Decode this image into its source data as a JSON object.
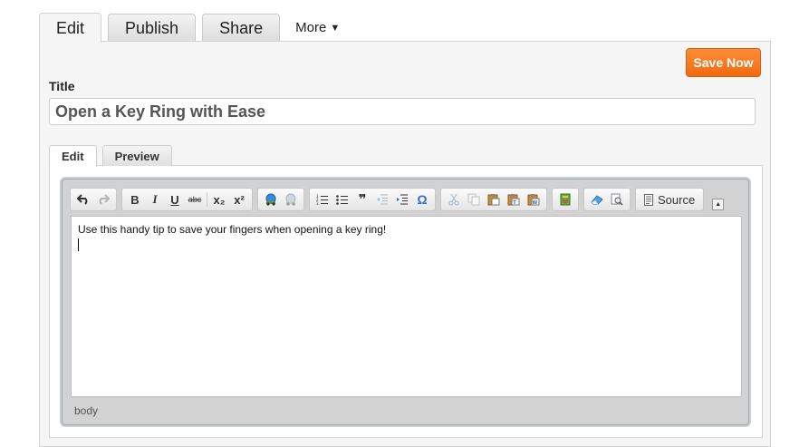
{
  "top_tabs": {
    "edit": "Edit",
    "publish": "Publish",
    "share": "Share",
    "more": "More"
  },
  "save_button": "Save Now",
  "title": {
    "label": "Title",
    "value": "Open a Key Ring with Ease"
  },
  "sub_tabs": {
    "edit": "Edit",
    "preview": "Preview"
  },
  "toolbar": {
    "bold": "B",
    "italic": "I",
    "underline": "U",
    "strike": "abc",
    "subscript": "x₂",
    "superscript": "x²",
    "blockquote": "❞",
    "special_char": "Ω",
    "source": "Source"
  },
  "editor": {
    "body_text": "Use this handy tip to save your fingers when opening a key ring!",
    "status_path": "body"
  },
  "colors": {
    "save_button": "#f37a24",
    "accent_blue": "#2a6fc0"
  }
}
